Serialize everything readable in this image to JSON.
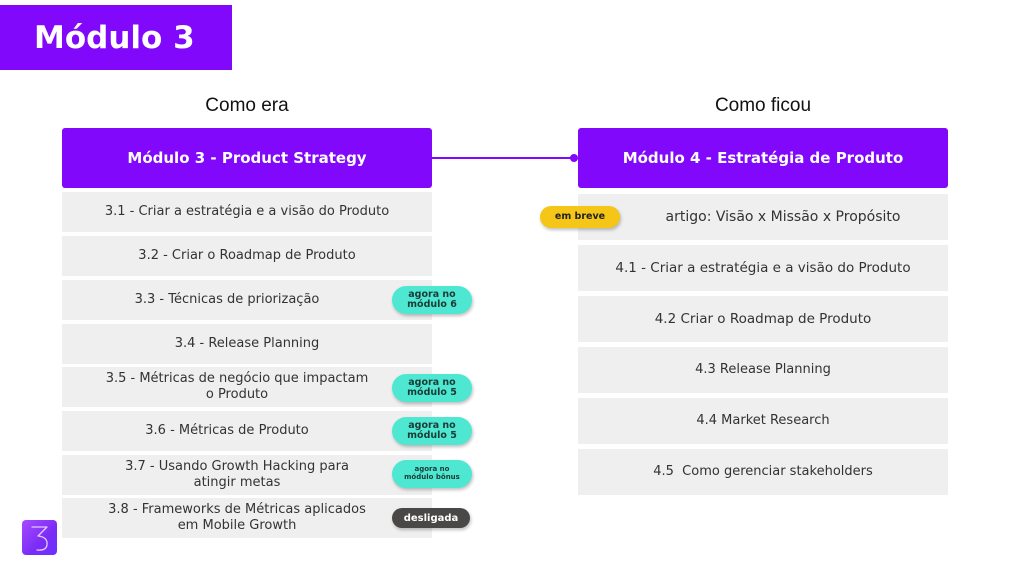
{
  "slide_title": "Módulo 3",
  "columns": {
    "left": {
      "heading": "Como era",
      "module_title": "Módulo 3 - Product Strategy",
      "items": [
        {
          "label": "3.1 - Criar a estratégia e a visão do Produto"
        },
        {
          "label": "3.2 - Criar o Roadmap de Produto"
        },
        {
          "label": "3.3 - Técnicas de priorização",
          "badge": "agora no módulo 6"
        },
        {
          "label": "3.4 - Release Planning"
        },
        {
          "label": "3.5 - Métricas de negócio que impactam o Produto",
          "badge": "agora no módulo 5"
        },
        {
          "label": "3.6 - Métricas de Produto",
          "badge": "agora no módulo 5"
        },
        {
          "label": "3.7 - Usando Growth Hacking para atingir metas",
          "badge": "agora no módulo bônus"
        },
        {
          "label": "3.8 - Frameworks de Métricas aplicados em Mobile Growth",
          "badge": "desligada"
        }
      ]
    },
    "right": {
      "heading": "Como ficou",
      "module_title": "Módulo 4 - Estratégia de Produto",
      "items": [
        {
          "label": "artigo: Visão x Missão x Propósito",
          "badge": "em breve"
        },
        {
          "label": "4.1 - Criar a estratégia e a visão do Produto"
        },
        {
          "label": "4.2 Criar o Roadmap de Produto"
        },
        {
          "label": "4.3 Release Planning"
        },
        {
          "label": "4.4 Market Research"
        },
        {
          "label": "4.5  Como gerenciar stakeholders"
        }
      ]
    }
  },
  "badge_lines": {
    "m6": [
      "agora no",
      "módulo 6"
    ],
    "m5a": [
      "agora no",
      "módulo 5"
    ],
    "m5b": [
      "agora no",
      "módulo 5"
    ],
    "bonus": [
      "agora no",
      "módulo bônus"
    ]
  },
  "colors": {
    "brand_purple": "#8208fb",
    "item_bg": "#efefef",
    "badge_teal": "#4ee8d2",
    "badge_dark": "#4a4747",
    "badge_yellow": "#f5c517"
  },
  "logo": {
    "icon": "number-3-logo-icon"
  }
}
